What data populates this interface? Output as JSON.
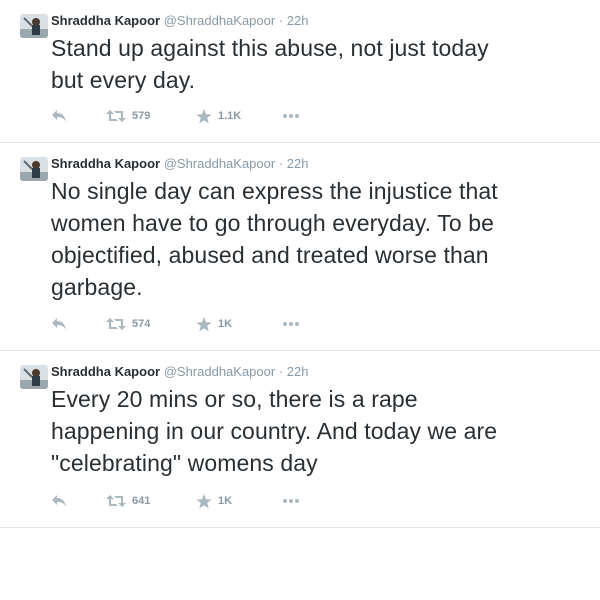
{
  "tweets": [
    {
      "name": "Shraddha Kapoor",
      "handle": "@ShraddhaKapoor",
      "separator": "·",
      "time": "22h",
      "text": "Stand up against this abuse, not just today\nbut every day.",
      "retweets": "579",
      "favorites": "1.1K"
    },
    {
      "name": "Shraddha Kapoor",
      "handle": "@ShraddhaKapoor",
      "separator": "·",
      "time": "22h",
      "text": "No single day can express the injustice that\nwomen have to go through everyday. To be\nobjectified, abused and treated worse than\ngarbage.",
      "retweets": "574",
      "favorites": "1K"
    },
    {
      "name": "Shraddha Kapoor",
      "handle": "@ShraddhaKapoor",
      "separator": "·",
      "time": "22h",
      "text": "Every 20 mins or so, there is a rape\nhappening in our country. And today we are\n\"celebrating\" womens day",
      "retweets": "641",
      "favorites": "1K"
    }
  ],
  "icons": {
    "reply": "reply-icon",
    "retweet": "retweet-icon",
    "favorite": "star-icon",
    "more": "more-dots-icon"
  },
  "colors": {
    "text": "#292f33",
    "muted": "#8899a6",
    "icon": "#aab8c2",
    "divider": "#e1e8ed"
  }
}
